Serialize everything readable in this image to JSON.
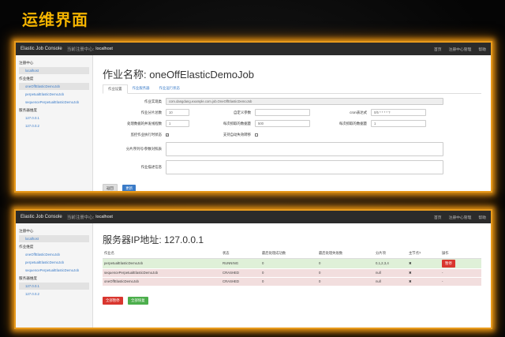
{
  "slide_title": "运维界面",
  "console": {
    "brand": "Elastic Job Console",
    "registry_label": "当前注册中心:",
    "host": "localhost",
    "nav_links": [
      "首页",
      "注册中心管理",
      "帮助"
    ]
  },
  "sidebar": {
    "registry_heading": "注册中心",
    "registry_items": [
      "localhost"
    ],
    "jobs_heading": "作业维度",
    "job_items": [
      "oneOffElasticDemoJob",
      "perpetualElasticDemoJob",
      "sequencePerpetualElasticDemoJob"
    ],
    "servers_heading": "服务器维度",
    "server_items": [
      "127.0.0.1",
      "127.0.0.2"
    ]
  },
  "job_page": {
    "title_prefix": "作业名称:",
    "job_name": "oneOffElasticDemoJob",
    "tabs": [
      "作业设置",
      "作业服务器",
      "作业运行状态"
    ],
    "fields": {
      "impl_class_label": "作业实现类",
      "impl_class_value": "com.dangdang.example.com.job.OneOffElasticDemoJob",
      "sharding_total_label": "作业分片总数",
      "sharding_total_value": "10",
      "custom_param_label": "自定义参数",
      "custom_param_value": "",
      "cron_label": "cron表达式",
      "cron_value": "0/5 * * * * ?",
      "concurrent_label": "处理数据的并发线程数",
      "concurrent_value": "1",
      "fetch_size_label": "每次抓取的数据量",
      "fetch_size_value": "1",
      "per_fetch_label": "每次抓取的数据量",
      "per_fetch_value": "500",
      "monitor_label": "监控作业执行时状态",
      "failover_label": "支持自动失效转移",
      "sharding_params_label": "分片序列号/参数对照表",
      "description_label": "作业描述信息"
    },
    "buttons": {
      "back": "返回",
      "save": "更新"
    }
  },
  "server_page": {
    "title": "服务器IP地址: 127.0.0.1",
    "columns": [
      "作业名",
      "状态",
      "最后处理成功数",
      "最后处理失败数",
      "分片项",
      "主节点?",
      "操作"
    ],
    "rows": [
      {
        "job": "perpetualElasticDemoJob",
        "status": "RUNNING",
        "success": "0",
        "fail": "0",
        "sharding": "0,1,2,3,4",
        "leader": "✖",
        "action": "暂停",
        "state": "ok"
      },
      {
        "job": "sequencePerpetualElasticDemoJob",
        "status": "CRASHED",
        "success": "0",
        "fail": "0",
        "sharding": "null",
        "leader": "✖",
        "action": "-",
        "state": "bad"
      },
      {
        "job": "oneOffElasticDemoJob",
        "status": "CRASHED",
        "success": "0",
        "fail": "0",
        "sharding": "null",
        "leader": "✖",
        "action": "-",
        "state": "bad"
      }
    ],
    "buttons": {
      "pause_all": "全部暂停",
      "resume_all": "全部恢复"
    }
  }
}
